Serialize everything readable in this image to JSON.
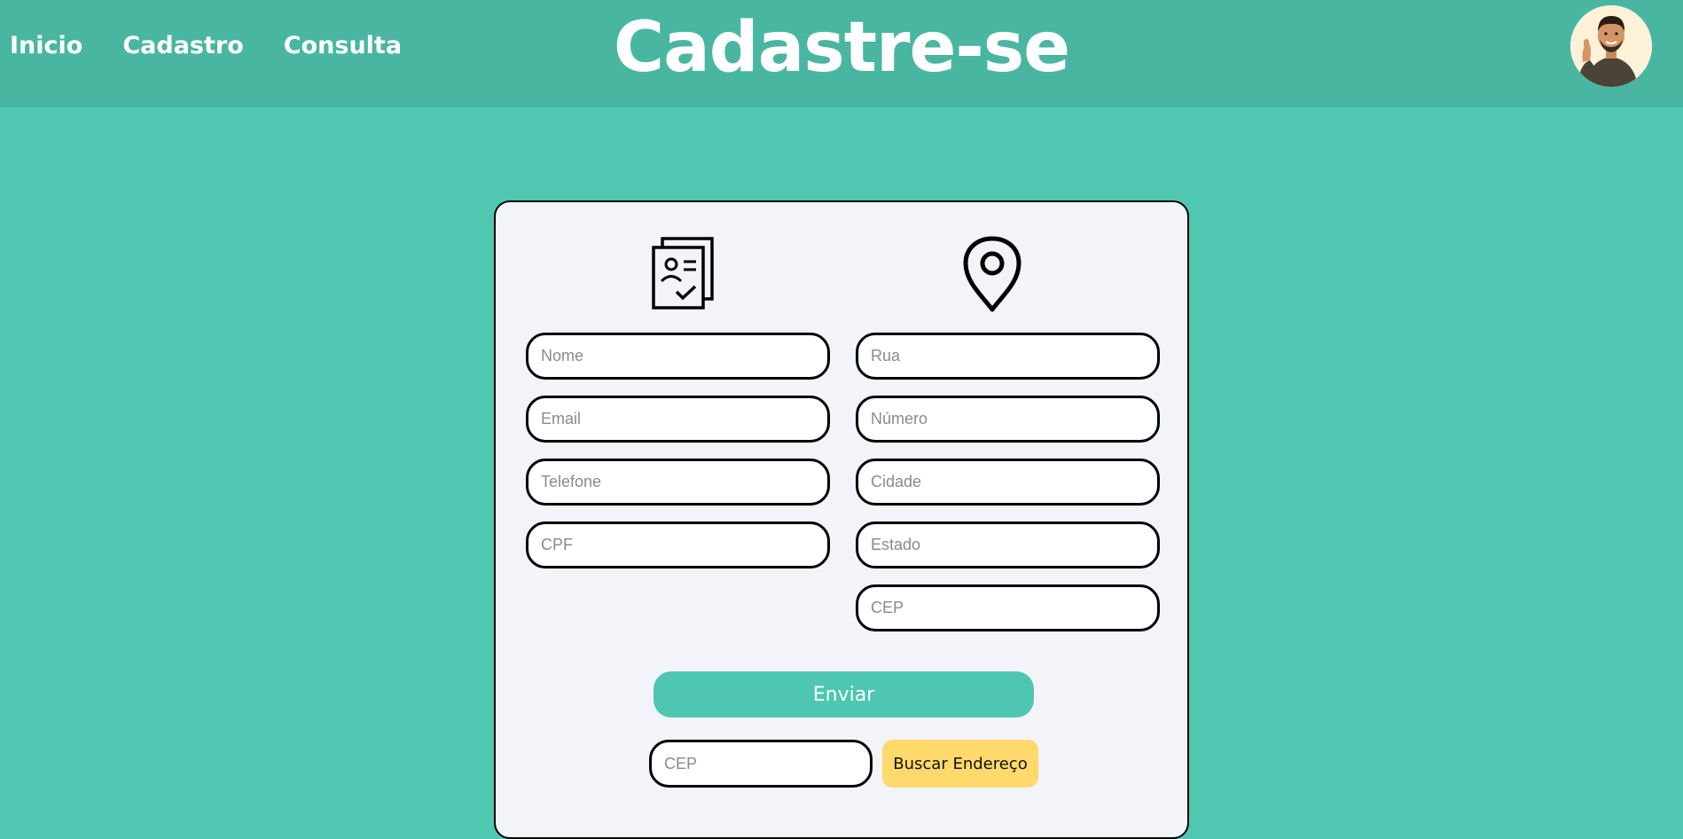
{
  "nav": {
    "items": [
      {
        "label": "Inicio"
      },
      {
        "label": "Cadastro"
      },
      {
        "label": "Consulta"
      }
    ]
  },
  "header": {
    "title": "Cadastre-se"
  },
  "colors": {
    "background": "#50c7b1",
    "header": "#49b6a2",
    "card": "#f3f4f9",
    "submit": "#4ec6b1",
    "search_button": "#ffd96b"
  },
  "form": {
    "personal_icon": "document-profile-icon",
    "address_icon": "map-pin-icon",
    "personal_fields": [
      {
        "placeholder": "Nome"
      },
      {
        "placeholder": "Email"
      },
      {
        "placeholder": "Telefone"
      },
      {
        "placeholder": "CPF"
      }
    ],
    "address_fields": [
      {
        "placeholder": "Rua"
      },
      {
        "placeholder": "Número"
      },
      {
        "placeholder": "Cidade"
      },
      {
        "placeholder": "Estado"
      },
      {
        "placeholder": "CEP"
      }
    ],
    "submit_label": "Enviar",
    "cep_search_placeholder": "CEP",
    "search_button_label": "Buscar Endereço"
  }
}
